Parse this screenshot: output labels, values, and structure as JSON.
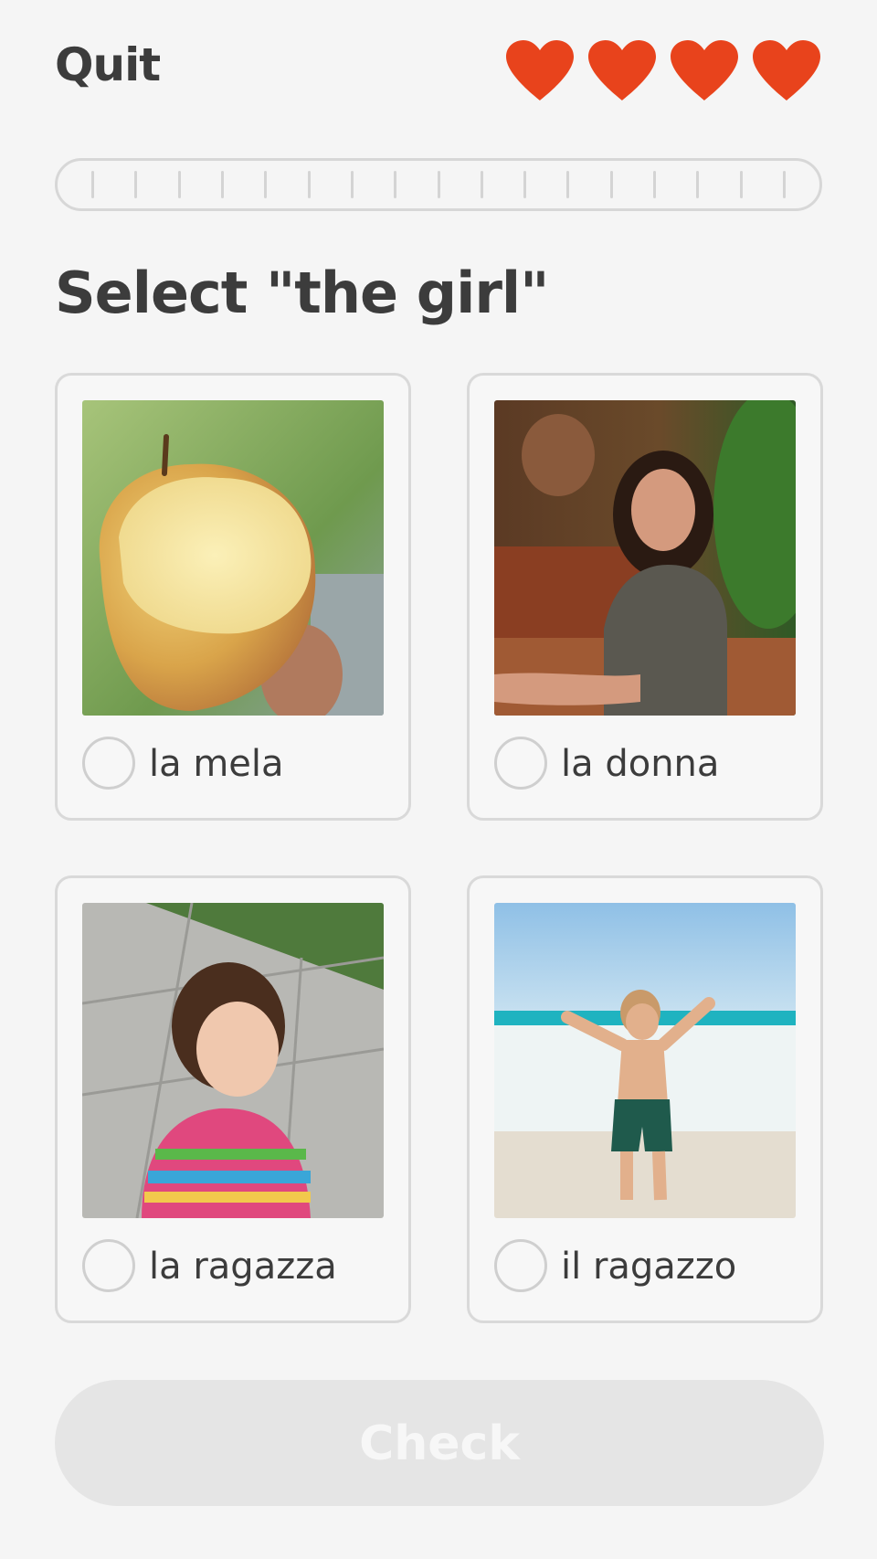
{
  "header": {
    "quit_label": "Quit",
    "hearts": 4,
    "heart_color": "#e8431c"
  },
  "progress": {
    "segments": 17,
    "filled_fraction": 0
  },
  "prompt": "Select \"the girl\"",
  "choices": [
    {
      "label": "la mela",
      "image": "apple-photo"
    },
    {
      "label": "la donna",
      "image": "woman-photo"
    },
    {
      "label": "la ragazza",
      "image": "girl-photo"
    },
    {
      "label": "il ragazzo",
      "image": "boy-photo"
    }
  ],
  "check_label": "Check",
  "colors": {
    "background": "#f5f5f5",
    "text": "#3c3c3c",
    "disabled_button": "#e5e5e5"
  }
}
